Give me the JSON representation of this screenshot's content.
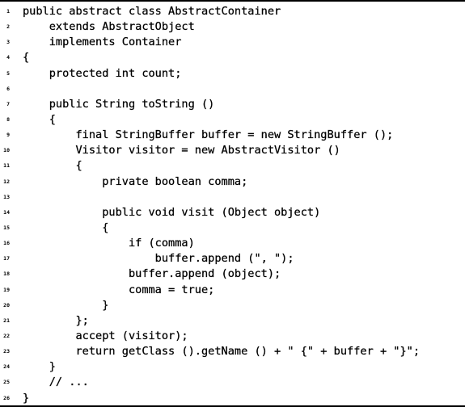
{
  "code": {
    "lines": [
      {
        "number": "1",
        "text": "public abstract class AbstractContainer"
      },
      {
        "number": "2",
        "text": "    extends AbstractObject"
      },
      {
        "number": "3",
        "text": "    implements Container"
      },
      {
        "number": "4",
        "text": "{"
      },
      {
        "number": "5",
        "text": "    protected int count;"
      },
      {
        "number": "6",
        "text": ""
      },
      {
        "number": "7",
        "text": "    public String toString ()"
      },
      {
        "number": "8",
        "text": "    {"
      },
      {
        "number": "9",
        "text": "        final StringBuffer buffer = new StringBuffer ();"
      },
      {
        "number": "10",
        "text": "        Visitor visitor = new AbstractVisitor ()"
      },
      {
        "number": "11",
        "text": "        {"
      },
      {
        "number": "12",
        "text": "            private boolean comma;"
      },
      {
        "number": "13",
        "text": ""
      },
      {
        "number": "14",
        "text": "            public void visit (Object object)"
      },
      {
        "number": "15",
        "text": "            {"
      },
      {
        "number": "16",
        "text": "                if (comma)"
      },
      {
        "number": "17",
        "text": "                    buffer.append (\", \");"
      },
      {
        "number": "18",
        "text": "                buffer.append (object);"
      },
      {
        "number": "19",
        "text": "                comma = true;"
      },
      {
        "number": "20",
        "text": "            }"
      },
      {
        "number": "21",
        "text": "        };"
      },
      {
        "number": "22",
        "text": "        accept (visitor);"
      },
      {
        "number": "23",
        "text": "        return getClass ().getName () + \" {\" + buffer + \"}\";"
      },
      {
        "number": "24",
        "text": "    }"
      },
      {
        "number": "25",
        "text": "    // ..."
      },
      {
        "number": "26",
        "text": "}"
      }
    ]
  }
}
